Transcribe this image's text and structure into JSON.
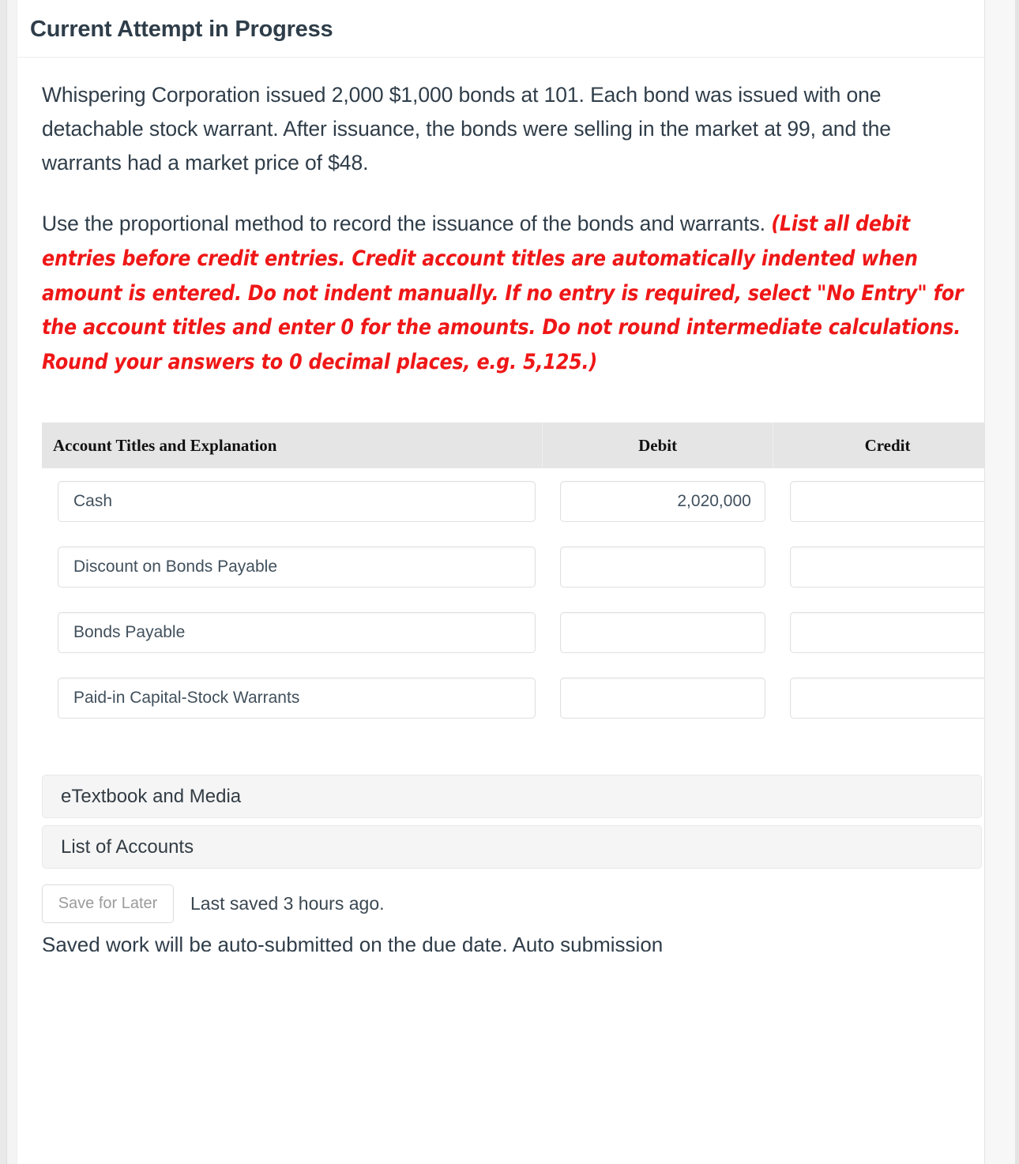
{
  "header": {
    "title": "Current Attempt in Progress"
  },
  "problem": {
    "paragraph1": "Whispering Corporation issued 2,000 $1,000 bonds at 101. Each bond was issued with one detachable stock warrant. After issuance, the bonds were selling in the market at 99, and the warrants had a market price of $48.",
    "paragraph2_lead": "Use the proportional method to record the issuance of the bonds and warrants. ",
    "paragraph2_instruction": "(List all debit entries before credit entries. Credit account titles are automatically indented when amount is entered. Do not indent manually. If no entry is required, select \"No Entry\" for the account titles and enter 0 for the amounts. Do not round intermediate calculations. Round your answers to 0 decimal places, e.g. 5,125.)"
  },
  "journal": {
    "columns": {
      "account": "Account Titles and Explanation",
      "debit": "Debit",
      "credit": "Credit"
    },
    "rows": [
      {
        "account": "Cash",
        "debit": "2,020,000",
        "credit": ""
      },
      {
        "account": "Discount on Bonds Payable",
        "debit": "",
        "credit": ""
      },
      {
        "account": "Bonds Payable",
        "debit": "",
        "credit": ""
      },
      {
        "account": "Paid-in Capital-Stock Warrants",
        "debit": "",
        "credit": ""
      }
    ]
  },
  "panels": {
    "etextbook": "eTextbook and Media",
    "list_of_accounts": "List of Accounts"
  },
  "footer": {
    "save_label": "Save for Later",
    "last_saved": "Last saved 3 hours ago.",
    "autosubmit_note": "Saved work will be auto-submitted on the due date. Auto submission"
  },
  "colors": {
    "instruction_red": "#ef1717",
    "title_slate": "#2e3d49",
    "table_header_bg": "#e5e5e5"
  }
}
